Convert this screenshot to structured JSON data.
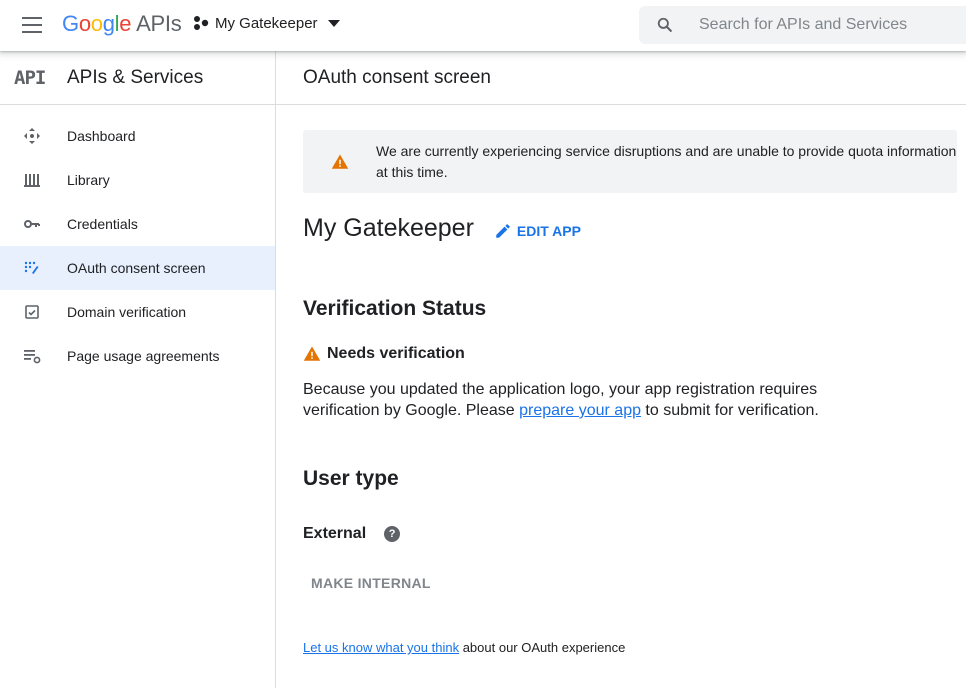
{
  "topbar": {
    "logo_google": [
      "G",
      "o",
      "o",
      "g",
      "l",
      "e"
    ],
    "logo_apis": "APIs",
    "project_name": "My Gatekeeper",
    "search_placeholder": "Search for APIs and Services"
  },
  "sidebar": {
    "logo_text": "API",
    "title": "APIs & Services",
    "items": [
      {
        "label": "Dashboard",
        "icon": "dashboard-icon"
      },
      {
        "label": "Library",
        "icon": "library-icon"
      },
      {
        "label": "Credentials",
        "icon": "key-icon"
      },
      {
        "label": "OAuth consent screen",
        "icon": "oauth-consent-icon",
        "active": true
      },
      {
        "label": "Domain verification",
        "icon": "domain-verification-icon"
      },
      {
        "label": "Page usage agreements",
        "icon": "settings-list-icon"
      }
    ]
  },
  "main": {
    "header": "OAuth consent screen",
    "banner_text": "We are currently experiencing service disruptions and are unable to provide quota information at this time.",
    "app_name": "My Gatekeeper",
    "edit_label": "EDIT APP",
    "verification_heading": "Verification Status",
    "needs_verification": "Needs verification",
    "para_before": "Because you updated the application logo, your app registration requires verification by Google. Please ",
    "para_link": "prepare your app",
    "para_after": " to submit for verification.",
    "user_type_heading": "User type",
    "user_type_value": "External",
    "help_glyph": "?",
    "make_internal_label": "MAKE INTERNAL",
    "feedback_link": "Let us know what you think",
    "feedback_after": " about our OAuth experience"
  },
  "colors": {
    "accent": "#1a73e8",
    "warning": "#e37400",
    "active_bg": "#e8f0fe"
  }
}
